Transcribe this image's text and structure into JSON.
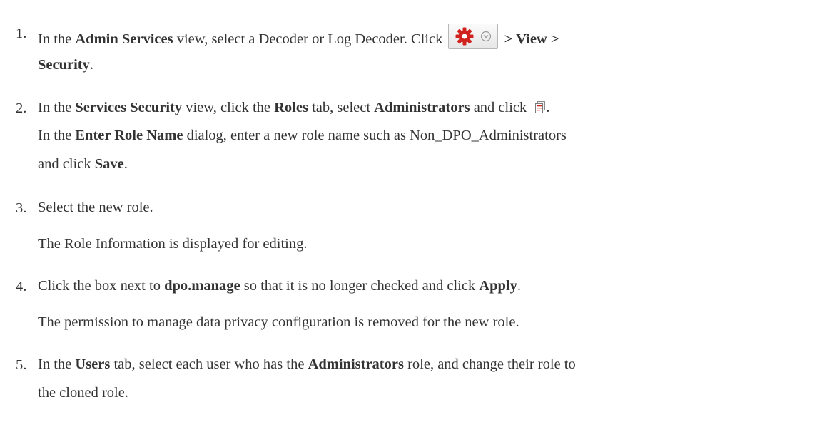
{
  "steps": [
    {
      "number": "1.",
      "line1": {
        "t1": "In the ",
        "b1": "Admin Services",
        "t2": " view, select a Decoder or Log Decoder. Click ",
        "b2": " > View >"
      },
      "line2": {
        "b1": "Security",
        "t1": "."
      },
      "icon": "gear-menu-icon"
    },
    {
      "number": "2.",
      "line1": {
        "t1": "In the ",
        "b1": "Services Security",
        "t2": " view, click the ",
        "b2": "Roles",
        "t3": " tab, select ",
        "b3": "Administrators",
        "t4": " and click ",
        "t5": "."
      },
      "line2": {
        "t1": "In the ",
        "b1": "Enter Role Name",
        "t2": " dialog, enter a new role name such as Non_DPO_Administrators"
      },
      "line3": {
        "t1": "and click ",
        "b1": "Save",
        "t2": "."
      },
      "icon": "clone-icon"
    },
    {
      "number": "3.",
      "line1": {
        "t1": "Select the new role."
      },
      "line2": {
        "t1": "The Role Information is displayed for editing."
      }
    },
    {
      "number": "4.",
      "line1": {
        "t1": "Click the box next to ",
        "b1": "dpo.manage",
        "t2": " so that it is no longer checked and click ",
        "b2": "Apply",
        "t3": "."
      },
      "line2": {
        "t1": "The permission to manage data privacy configuration is removed for the new role."
      }
    },
    {
      "number": "5.",
      "line1": {
        "t1": "In the ",
        "b1": "Users",
        "t2": " tab, select each user who has the ",
        "b2": "Administrators",
        "t3": " role, and change their role to"
      },
      "line2": {
        "t1": "the cloned role."
      }
    }
  ],
  "colors": {
    "text": "#333333",
    "gear": "#d0221e",
    "chevron": "#9a9a9a"
  }
}
